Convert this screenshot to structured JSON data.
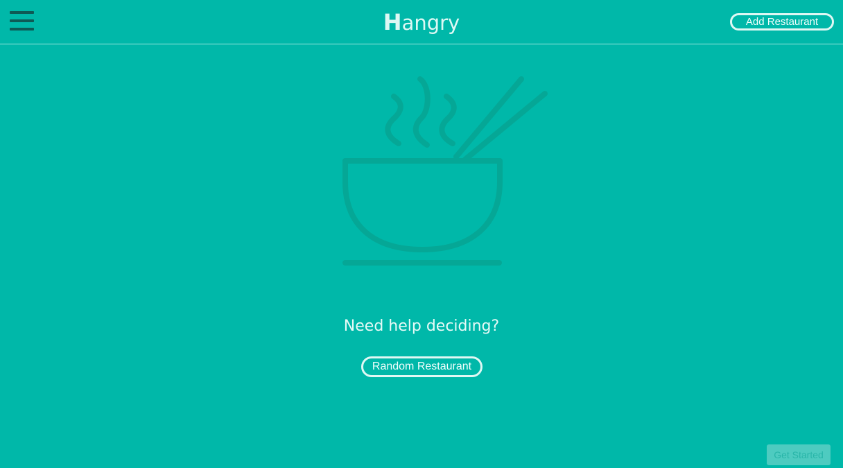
{
  "header": {
    "brand_initial": "H",
    "brand_rest": "angry",
    "add_restaurant_label": "Add Restaurant",
    "menu_icon": "hamburger-menu-icon"
  },
  "main": {
    "illustration_icon": "noodle-bowl-chopsticks-icon",
    "prompt": "Need help deciding?",
    "random_button_label": "Random Restaurant"
  },
  "footer": {
    "get_started_label": "Get Started"
  },
  "colors": {
    "background": "#00b8a9",
    "illustration_stroke": "#05a796",
    "menu_icon": "#0e5a55",
    "button_outline": "#dff8f4",
    "get_started_bg": "#4ecbc0"
  }
}
